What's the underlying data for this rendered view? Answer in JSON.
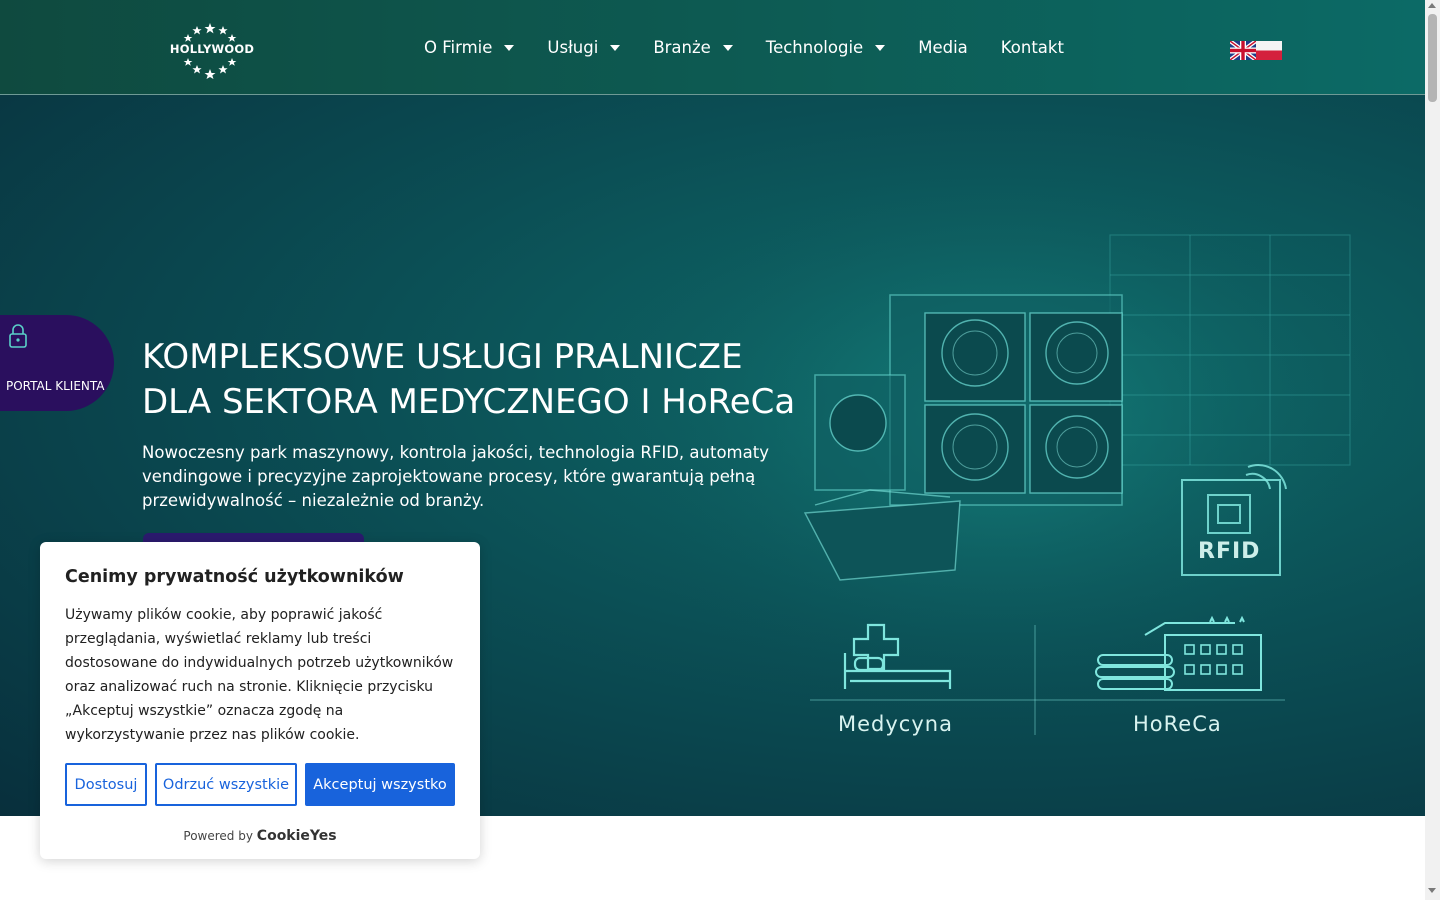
{
  "header": {
    "logo_text": "HOLLYWOOD",
    "nav": [
      {
        "label": "O Firmie",
        "has_dropdown": true
      },
      {
        "label": "Usługi",
        "has_dropdown": true
      },
      {
        "label": "Branże",
        "has_dropdown": true
      },
      {
        "label": "Technologie",
        "has_dropdown": true
      },
      {
        "label": "Media",
        "has_dropdown": false
      },
      {
        "label": "Kontakt",
        "has_dropdown": false
      }
    ],
    "languages": [
      "en-flag-icon",
      "pl-flag-icon"
    ]
  },
  "hero": {
    "title_line1": "KOMPLEKSOWE USŁUGI PRALNICZE",
    "title_line2": "DLA SEKTORA MEDYCZNEGO I HoReCa",
    "description": "Nowoczesny park maszynowy, kontrola jakości, technologia RFID, automaty vendingowe i precyzyjne zaprojektowane procesy, które gwarantują pełną przewidywalność – niezależnie od branży.",
    "rfid_label": "RFID",
    "sector_medical": "Medycyna",
    "sector_horeca": "HoReCa"
  },
  "portal": {
    "label": "PORTAL KLIENTA",
    "icon": "lock-icon"
  },
  "cookie": {
    "title": "Cenimy prywatność użytkowników",
    "text": "Używamy plików cookie, aby poprawić jakość przeglądania, wyświetlać reklamy lub treści dostosowane do indywidualnych potrzeb użytkowników oraz analizować ruch na stronie. Kliknięcie przycisku „Akceptuj wszystkie” oznacza zgodę na wykorzystywanie przez nas plików cookie.",
    "btn_customize": "Dostosuj",
    "btn_reject": "Odrzuć wszystkie",
    "btn_accept": "Akceptuj wszystko",
    "powered_by": "Powered by",
    "brand": "CookieYes"
  },
  "colors": {
    "header_bg": "#0d5a52",
    "portal_bg": "#2a0f5e",
    "accept_blue": "#1863dc"
  }
}
